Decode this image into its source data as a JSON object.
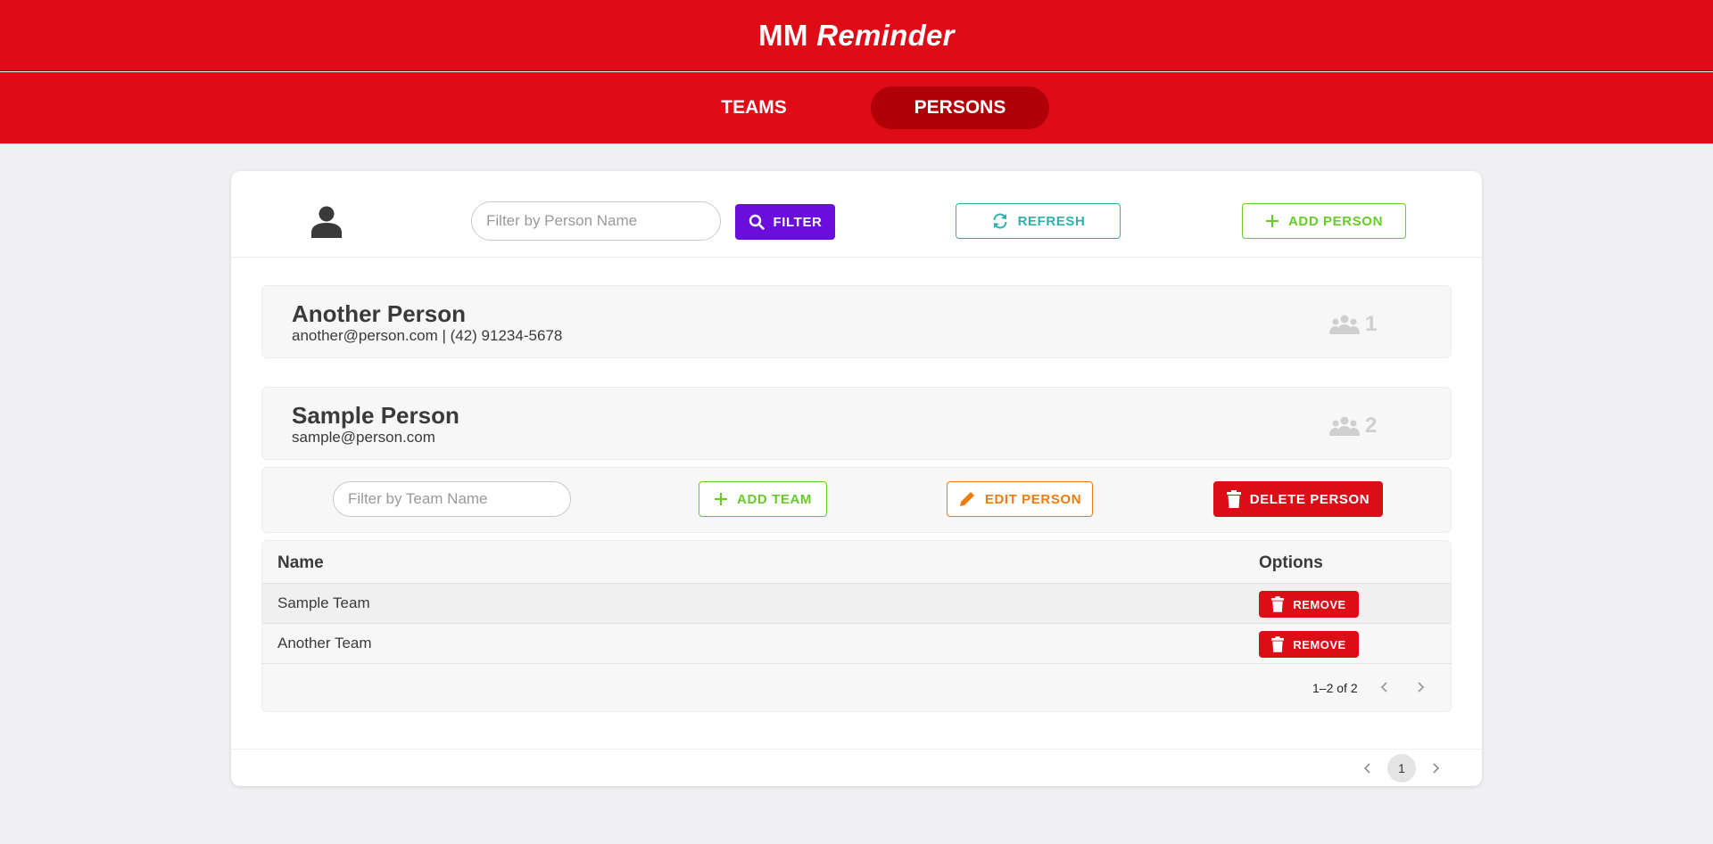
{
  "header": {
    "brand_main": "MM",
    "brand_accent": "Reminder"
  },
  "nav": {
    "tabs": [
      {
        "label": "TEAMS",
        "active": false
      },
      {
        "label": "PERSONS",
        "active": true
      }
    ]
  },
  "toolbar": {
    "person_filter_placeholder": "Filter by Person Name",
    "filter_label": "FILTER",
    "refresh_label": "REFRESH",
    "add_person_label": "ADD PERSON"
  },
  "persons": [
    {
      "name": "Another Person",
      "details": "another@person.com | (42) 91234-5678",
      "team_count": "1"
    },
    {
      "name": "Sample Person",
      "details": "sample@person.com",
      "team_count": "2"
    }
  ],
  "person_actions": {
    "team_filter_placeholder": "Filter by Team Name",
    "add_team_label": "ADD TEAM",
    "edit_person_label": "EDIT PERSON",
    "delete_person_label": "DELETE PERSON"
  },
  "teams_table": {
    "columns": [
      "Name",
      "Options"
    ],
    "rows": [
      {
        "name": "Sample Team",
        "action": "REMOVE"
      },
      {
        "name": "Another Team",
        "action": "REMOVE"
      }
    ],
    "range_text": "1–2 of 2"
  },
  "pagination": {
    "current_page": "1"
  },
  "colors": {
    "brand_red": "#df0b16",
    "active_tab": "#b00008",
    "filter_purple": "#6a0edc",
    "refresh_teal": "#2bb3ad",
    "add_green": "#67cb2a",
    "edit_orange": "#f07c0f",
    "delete_red": "#dc0d16"
  }
}
